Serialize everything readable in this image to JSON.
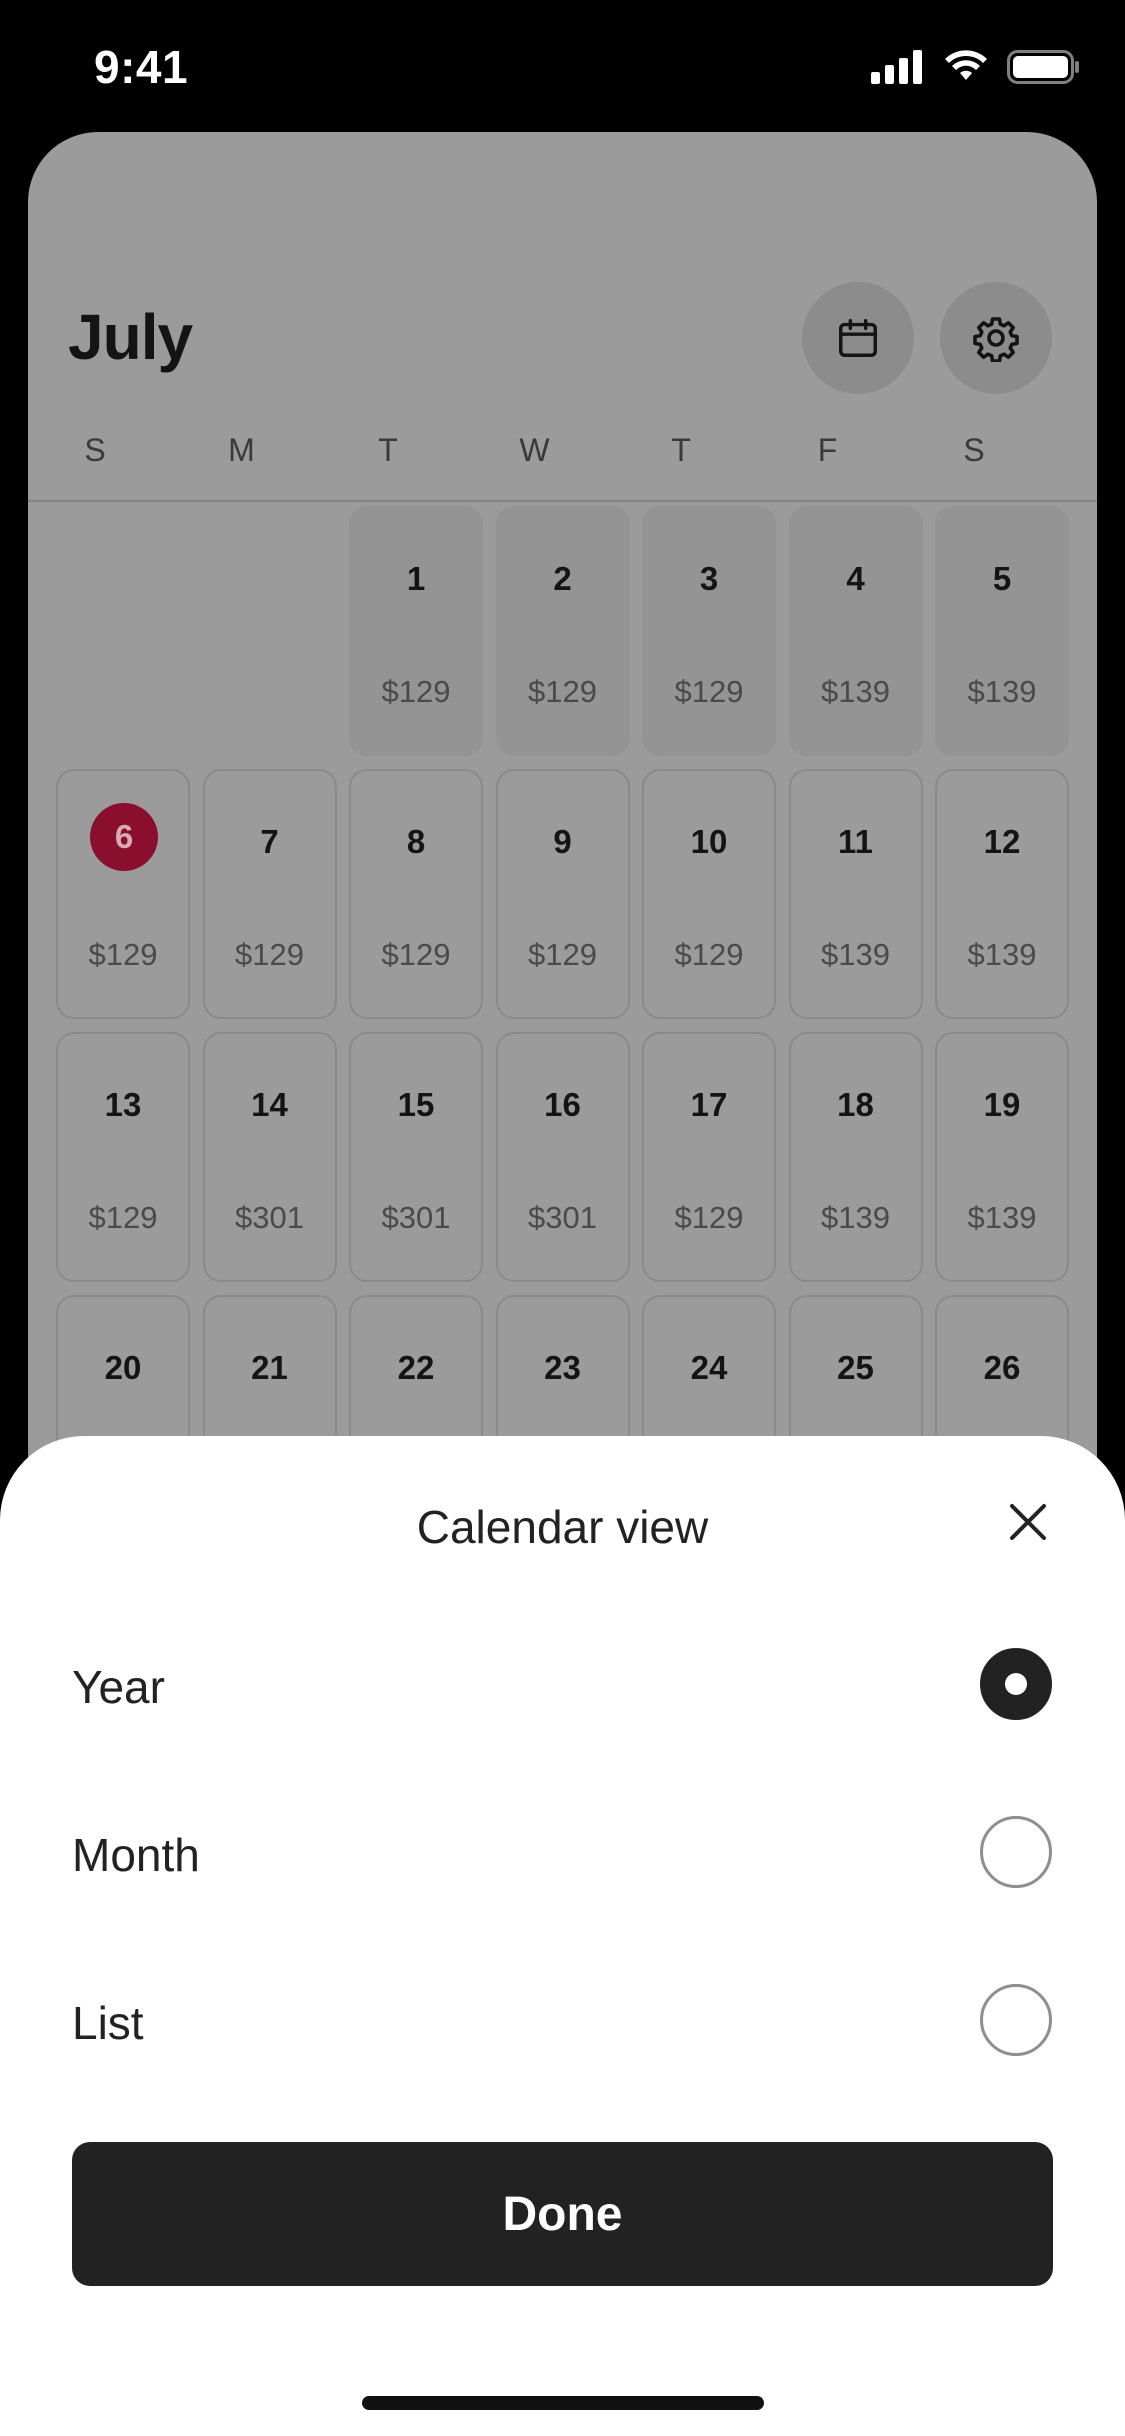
{
  "status_bar": {
    "time": "9:41"
  },
  "calendar": {
    "month": "July",
    "weekdays": [
      "S",
      "M",
      "T",
      "W",
      "T",
      "F",
      "S"
    ],
    "weeks": [
      [
        null,
        null,
        {
          "day": "1",
          "price": "$129"
        },
        {
          "day": "2",
          "price": "$129"
        },
        {
          "day": "3",
          "price": "$129"
        },
        {
          "day": "4",
          "price": "$139"
        },
        {
          "day": "5",
          "price": "$139"
        }
      ],
      [
        {
          "day": "6",
          "price": "$129",
          "today": true
        },
        {
          "day": "7",
          "price": "$129"
        },
        {
          "day": "8",
          "price": "$129"
        },
        {
          "day": "9",
          "price": "$129"
        },
        {
          "day": "10",
          "price": "$129"
        },
        {
          "day": "11",
          "price": "$139"
        },
        {
          "day": "12",
          "price": "$139"
        }
      ],
      [
        {
          "day": "13",
          "price": "$129"
        },
        {
          "day": "14",
          "price": "$301"
        },
        {
          "day": "15",
          "price": "$301"
        },
        {
          "day": "16",
          "price": "$301"
        },
        {
          "day": "17",
          "price": "$129"
        },
        {
          "day": "18",
          "price": "$139"
        },
        {
          "day": "19",
          "price": "$139"
        }
      ],
      [
        {
          "day": "20",
          "price": ""
        },
        {
          "day": "21",
          "price": ""
        },
        {
          "day": "22",
          "price": ""
        },
        {
          "day": "23",
          "price": ""
        },
        {
          "day": "24",
          "price": ""
        },
        {
          "day": "25",
          "price": ""
        },
        {
          "day": "26",
          "price": ""
        }
      ]
    ],
    "today_color": "#8a0f2e"
  },
  "sheet": {
    "title": "Calendar view",
    "options": [
      {
        "label": "Year",
        "selected": true
      },
      {
        "label": "Month",
        "selected": false
      },
      {
        "label": "List",
        "selected": false
      }
    ],
    "done_label": "Done"
  },
  "icons": {
    "calendar_button": "calendar-icon",
    "settings_button": "gear-icon",
    "close": "close-icon"
  }
}
